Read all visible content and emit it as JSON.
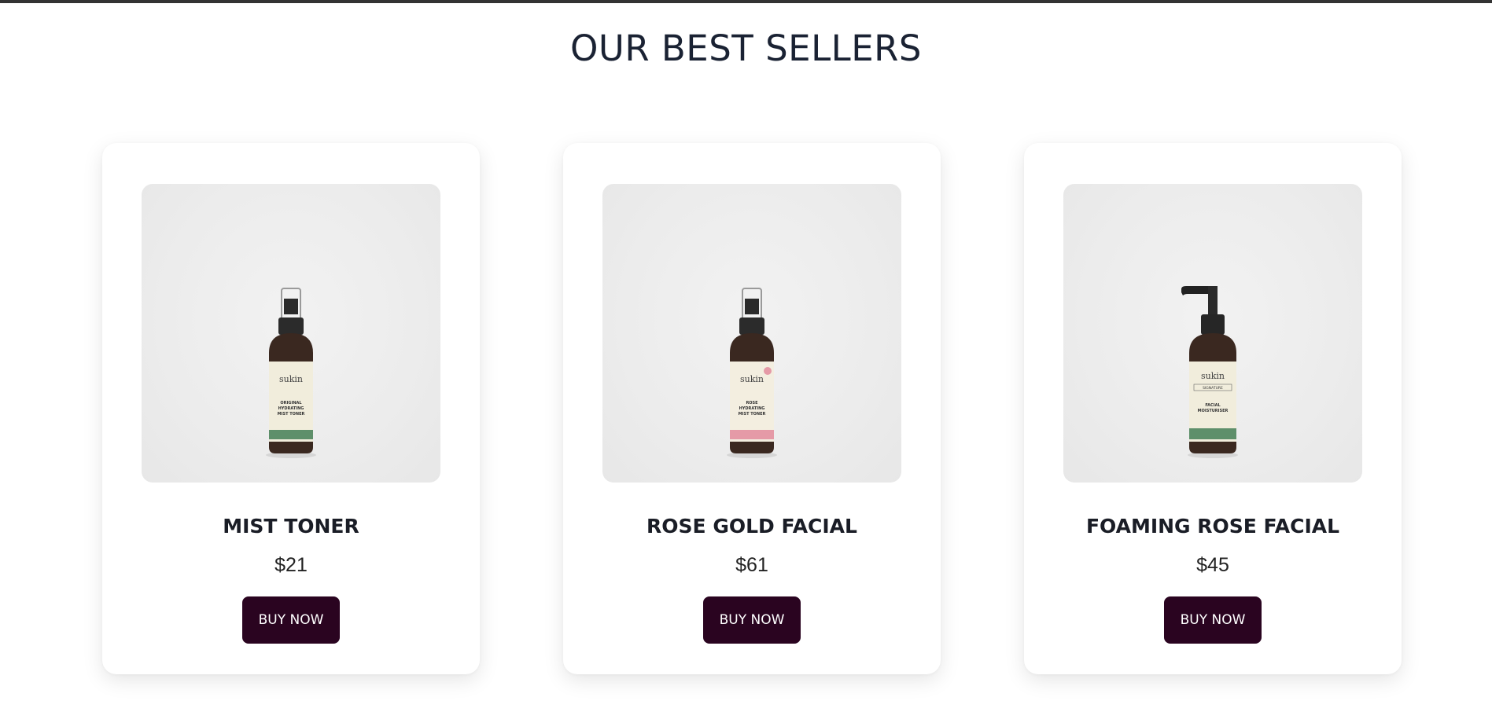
{
  "section": {
    "title": "OUR BEST SELLERS"
  },
  "products": [
    {
      "name": "MIST TONER",
      "price": "$21",
      "button_label": "BUY NOW",
      "label": {
        "brand": "sukin",
        "line1": "ORIGINAL",
        "line2": "HYDRATING",
        "line3": "MIST TONER"
      },
      "band_color": "#5e8f6a",
      "cap": "mist-sprayer"
    },
    {
      "name": "ROSE GOLD FACIAL",
      "price": "$61",
      "button_label": "BUY NOW",
      "label": {
        "brand": "sukin",
        "line1": "ROSE",
        "line2": "HYDRATING",
        "line3": "MIST TONER"
      },
      "band_color": "#e59aa7",
      "cap": "mist-sprayer"
    },
    {
      "name": "FOAMING ROSE FACIAL",
      "price": "$45",
      "button_label": "BUY NOW",
      "label": {
        "brand": "sukin",
        "line1": "SIGNATURE",
        "line2": "FACIAL",
        "line3": "MOISTURISER"
      },
      "band_color": "#5e8f6a",
      "cap": "pump-dispenser"
    }
  ],
  "colors": {
    "button_bg": "#2a0420",
    "title_text": "#1a2233",
    "top_bar": "#333333"
  }
}
